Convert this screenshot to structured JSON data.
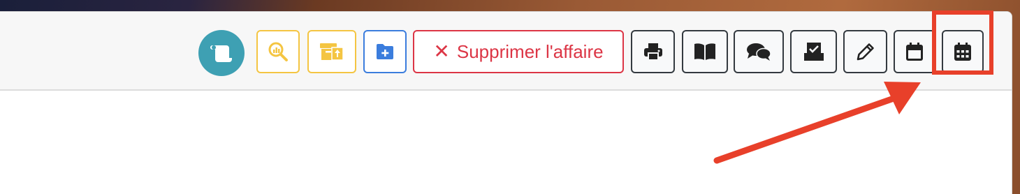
{
  "toolbar": {
    "delete_label": "Supprimer l'affaire",
    "delete_x": "✕"
  },
  "icons": {
    "avatar": "scroll-icon",
    "search_chart": "search-analytics-icon",
    "archive_upload": "archive-upload-icon",
    "folder_add": "folder-plus-icon",
    "print": "print-icon",
    "book": "book-icon",
    "comments": "comments-icon",
    "inbox_check": "inbox-check-icon",
    "pencil": "pencil-icon",
    "calendar_day": "calendar-icon",
    "calendar_grid": "calendar-days-icon"
  },
  "colors": {
    "avatar": "#3ea0b3",
    "warning": "#f4c542",
    "primary": "#3b7ddd",
    "danger": "#dc3545",
    "dark": "#343a40",
    "annotation": "#e8402a"
  }
}
